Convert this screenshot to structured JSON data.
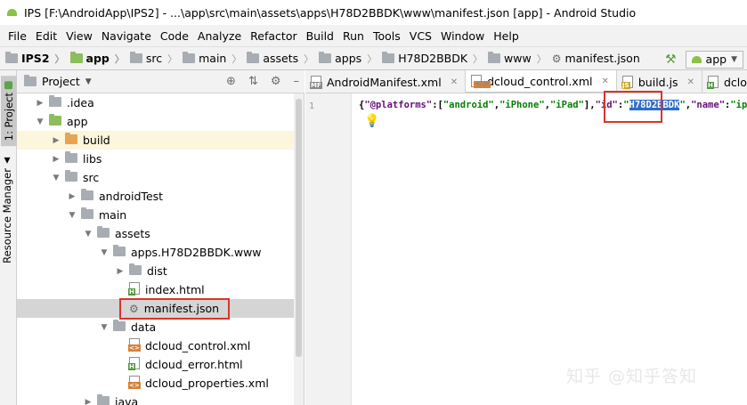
{
  "window": {
    "title": "IPS [F:\\AndroidApp\\IPS2] - ...\\app\\src\\main\\assets\\apps\\H78D2BBDK\\www\\manifest.json [app] - Android Studio"
  },
  "menu": [
    "File",
    "Edit",
    "View",
    "Navigate",
    "Code",
    "Analyze",
    "Refactor",
    "Build",
    "Run",
    "Tools",
    "VCS",
    "Window",
    "Help"
  ],
  "breadcrumb": [
    "IPS2",
    "app",
    "src",
    "main",
    "assets",
    "apps",
    "H78D2BBDK",
    "www",
    "manifest.json"
  ],
  "run_config": "app",
  "left_strip": {
    "project_tab": "1: Project",
    "resource_tab": "Resource Manager"
  },
  "project_panel": {
    "title": "Project"
  },
  "tree": [
    {
      "label": ".idea",
      "level": 1,
      "arrow": "right",
      "icon": "folder"
    },
    {
      "label": "app",
      "level": 1,
      "arrow": "down",
      "icon": "folder-green"
    },
    {
      "label": "build",
      "level": 2,
      "arrow": "right",
      "icon": "folder-orange"
    },
    {
      "label": "libs",
      "level": 2,
      "arrow": "right",
      "icon": "folder"
    },
    {
      "label": "src",
      "level": 2,
      "arrow": "down",
      "icon": "folder"
    },
    {
      "label": "androidTest",
      "level": 3,
      "arrow": "right",
      "icon": "folder"
    },
    {
      "label": "main",
      "level": 3,
      "arrow": "down",
      "icon": "folder"
    },
    {
      "label": "assets",
      "level": 4,
      "arrow": "down",
      "icon": "folder"
    },
    {
      "label": "apps.H78D2BBDK.www",
      "level": 5,
      "arrow": "down",
      "icon": "folder"
    },
    {
      "label": "dist",
      "level": 6,
      "arrow": "right",
      "icon": "folder"
    },
    {
      "label": "index.html",
      "level": 6,
      "arrow": "",
      "icon": "html"
    },
    {
      "label": "manifest.json",
      "level": 6,
      "arrow": "",
      "icon": "json"
    },
    {
      "label": "data",
      "level": 5,
      "arrow": "down",
      "icon": "folder"
    },
    {
      "label": "dcloud_control.xml",
      "level": 6,
      "arrow": "",
      "icon": "xml"
    },
    {
      "label": "dcloud_error.html",
      "level": 6,
      "arrow": "",
      "icon": "html"
    },
    {
      "label": "dcloud_properties.xml",
      "level": 6,
      "arrow": "",
      "icon": "xml"
    },
    {
      "label": "java",
      "level": 4,
      "arrow": "right",
      "icon": "folder"
    }
  ],
  "editor_tabs": [
    {
      "label": "AndroidManifest.xml",
      "badge": "MF"
    },
    {
      "label": "dcloud_control.xml",
      "badge": "<>"
    },
    {
      "label": "build.js",
      "badge": "JS"
    },
    {
      "label": "dcloud_er",
      "badge": "H"
    }
  ],
  "editor": {
    "line_number": "1",
    "code": {
      "p1": "{",
      "k1": "\"@platforms\"",
      "p2": ":[",
      "s1": "\"android\"",
      "p3": ",",
      "s2": "\"iPhone\"",
      "p4": ",",
      "s3": "\"iPad\"",
      "p5": "],",
      "k2": "\"id\"",
      "p6": ":",
      "q1": "\"",
      "selected": "H78D2BBDK",
      "q2": "\"",
      "p7": ",",
      "k3": "\"name\"",
      "p8": ":",
      "s4": "\"ips\"",
      "p9": ","
    }
  },
  "watermark": "知乎 @知乎答知"
}
